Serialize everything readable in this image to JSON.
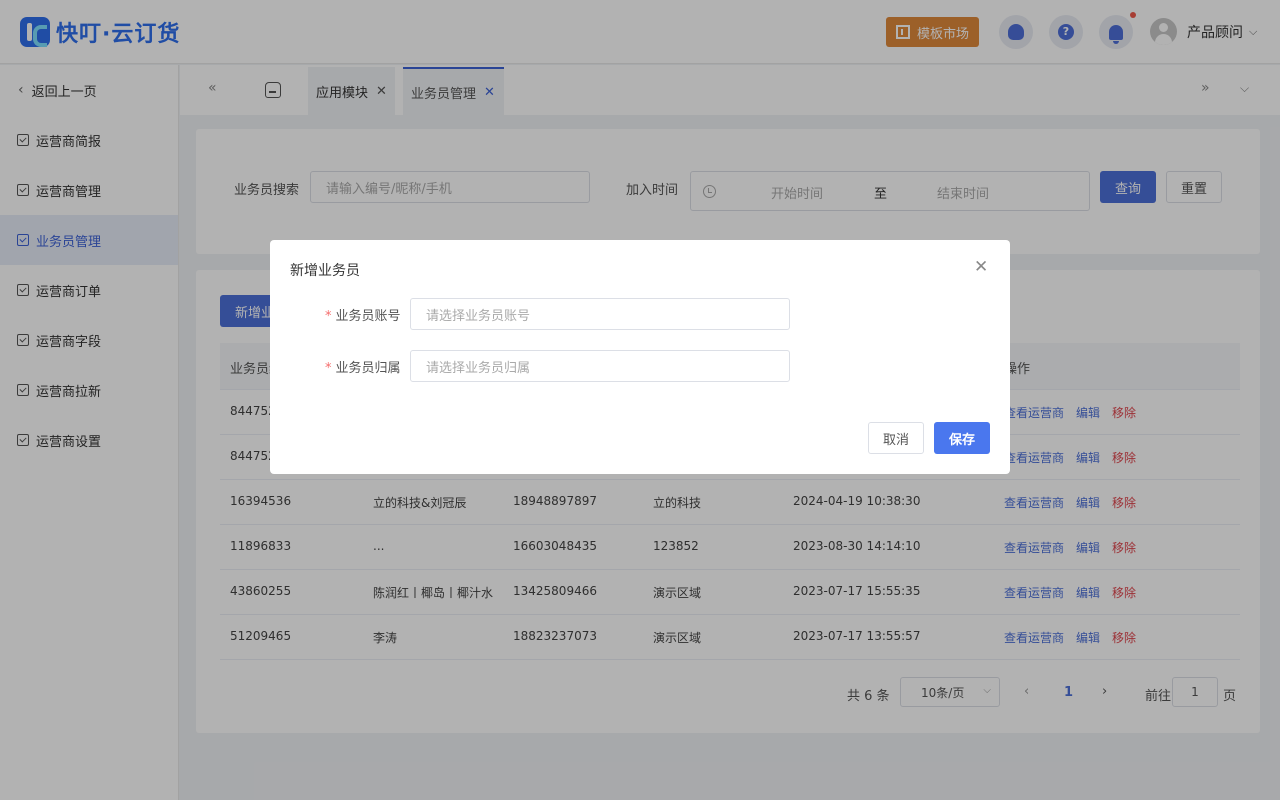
{
  "header": {
    "logo_text": "快叮·云订货",
    "market_label": "模板市场",
    "help_glyph": "?",
    "user_name": "产品顾问",
    "icons": [
      "service-icon",
      "help-icon",
      "bell-icon",
      "avatar"
    ]
  },
  "sidebar": {
    "back_label": "返回上一页",
    "items": [
      {
        "label": "运营商简报"
      },
      {
        "label": "运营商管理"
      },
      {
        "label": "业务员管理"
      },
      {
        "label": "运营商订单"
      },
      {
        "label": "运营商字段"
      },
      {
        "label": "运营商拉新"
      },
      {
        "label": "运营商设置"
      }
    ],
    "active_index": 2
  },
  "tabs": [
    {
      "label": "应用模块"
    },
    {
      "label": "业务员管理"
    }
  ],
  "search": {
    "keyword_label": "业务员搜索",
    "keyword_placeholder": "请输入编号/昵称/手机",
    "date_label": "加入时间",
    "start_placeholder": "开始时间",
    "separator": "至",
    "end_placeholder": "结束时间",
    "query_label": "查询",
    "reset_label": "重置"
  },
  "table": {
    "add_label": "新增业",
    "columns": [
      "业务员编",
      "",
      "",
      "",
      "",
      "操作"
    ],
    "rows": [
      {
        "id": "844752",
        "name": "",
        "phone": "",
        "region": "",
        "time": ""
      },
      {
        "id": "844752",
        "name": "",
        "phone": "",
        "region": "",
        "time": ""
      },
      {
        "id": "16394536",
        "name": "立的科技&刘冠辰",
        "phone": "18948897897",
        "region": "立的科技",
        "time": "2024-04-19 10:38:30"
      },
      {
        "id": "11896833",
        "name": "...",
        "phone": "16603048435",
        "region": "123852",
        "time": "2023-08-30 14:14:10"
      },
      {
        "id": "43860255",
        "name": "陈润红丨椰岛丨椰汁水",
        "phone": "13425809466",
        "region": "演示区域",
        "time": "2023-07-17 15:55:35"
      },
      {
        "id": "51209465",
        "name": "李涛",
        "phone": "18823237073",
        "region": "演示区域",
        "time": "2023-07-17 13:55:57"
      }
    ],
    "actions": {
      "view": "查看运营商",
      "edit": "编辑",
      "remove": "移除"
    }
  },
  "pagination": {
    "total_text": "共 6 条",
    "page_size": "10条/页",
    "current_page": "1",
    "goto_label": "前往",
    "goto_value": "1",
    "page_suffix": "页"
  },
  "modal": {
    "title": "新增业务员",
    "fields": [
      {
        "required_mark": "*",
        "label": "业务员账号",
        "placeholder": "请选择业务员账号"
      },
      {
        "required_mark": "*",
        "label": "业务员归属",
        "placeholder": "请选择业务员归属"
      }
    ],
    "cancel_label": "取消",
    "save_label": "保存"
  },
  "colors": {
    "primary": "#4d70d8",
    "market": "#e08a3c",
    "danger": "#e0464e"
  }
}
